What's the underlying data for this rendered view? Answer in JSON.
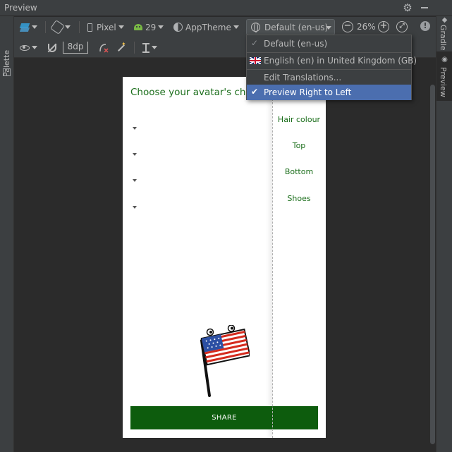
{
  "window": {
    "title": "Preview"
  },
  "left_strip": {
    "palette_label": "Palette"
  },
  "right_strip": {
    "gradle_label": "Gradle",
    "preview_label": "Preview"
  },
  "toolbar": {
    "device_label": "Pixel",
    "api_label": "29",
    "theme_label": "AppTheme",
    "locale_label": "Default (en-us)",
    "zoom_label": "26%",
    "margin_label": "8dp"
  },
  "locale_menu": {
    "items": [
      {
        "label": "Default (en-us)"
      },
      {
        "label": "English (en) in United Kingdom (GB)"
      },
      {
        "label": "Edit Translations..."
      },
      {
        "label": "Preview Right to Left"
      }
    ]
  },
  "device": {
    "header": "Choose your avatar's char",
    "rtl_labels": [
      "Hair colour",
      "Top",
      "Bottom",
      "Shoes"
    ],
    "share_label": "SHARE"
  },
  "colors": {
    "accent_green": "#0d5c0d",
    "text_green": "#1b6e1b",
    "menu_selected": "#4b6eaf"
  }
}
